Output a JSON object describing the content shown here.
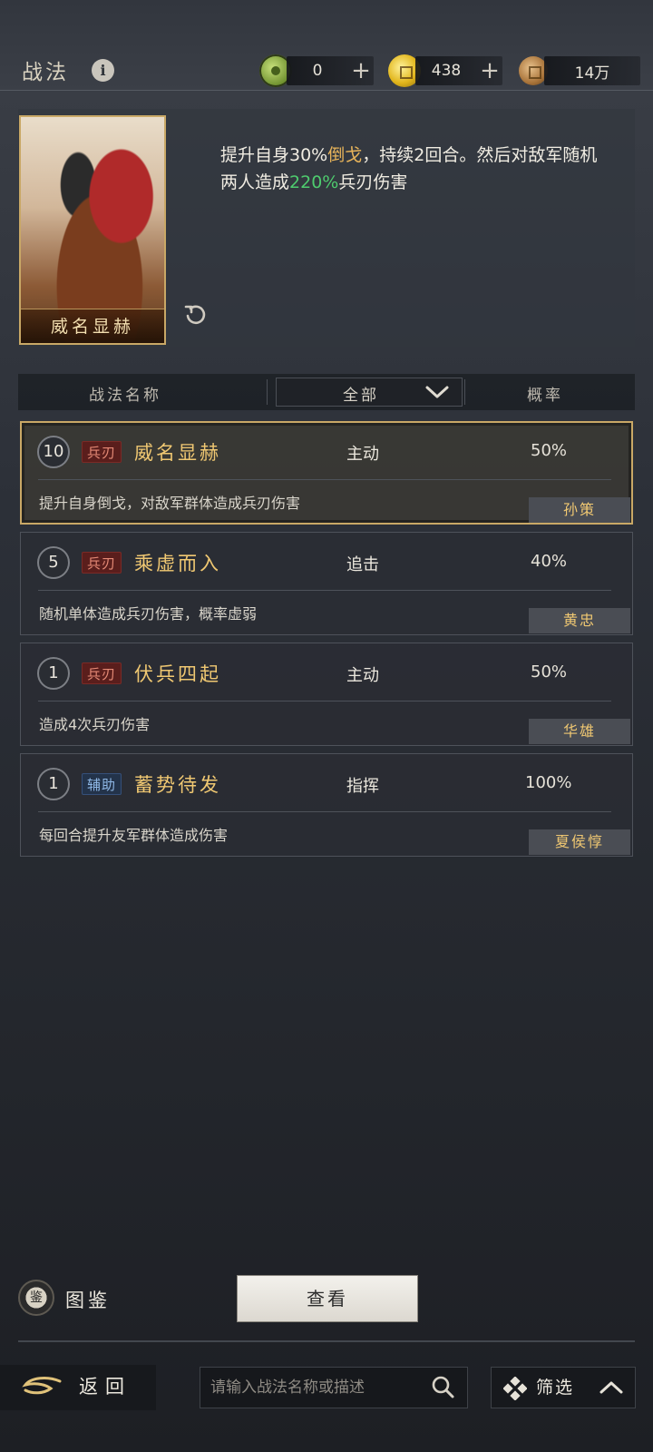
{
  "header": {
    "title": "战法",
    "info_icon": "info-icon",
    "resources": [
      {
        "icon": "jade-coin-icon",
        "value": "0",
        "has_plus": true
      },
      {
        "icon": "gold-coin-icon",
        "value": "438",
        "has_plus": true
      },
      {
        "icon": "copper-coin-icon",
        "value": "14万",
        "has_plus": false
      }
    ],
    "plus_symbol": "+"
  },
  "hero": {
    "card_name": "威名显赫",
    "description": {
      "p1": "提升自身30%",
      "highlight1": "倒戈",
      "p2": "，持续2回合。然后对敌军随机两人造成",
      "highlight2": "220%",
      "p3": "兵刃伤害"
    },
    "highlight_colors": {
      "gold": "#e7b35a",
      "green": "#4ecb6e"
    }
  },
  "list_header": {
    "name_col": "战法名称",
    "filter_value": "全部",
    "rate_col": "概率"
  },
  "skills": [
    {
      "level": "10",
      "tag": "兵刃",
      "tag_color": "red",
      "name": "威名显赫",
      "type": "主动",
      "rate": "50%",
      "desc": "提升自身倒戈，对敌军群体造成兵刃伤害",
      "owner": "孙策",
      "selected": true
    },
    {
      "level": "5",
      "tag": "兵刃",
      "tag_color": "red",
      "name": "乘虚而入",
      "type": "追击",
      "rate": "40%",
      "desc": "随机单体造成兵刃伤害，概率虚弱",
      "owner": "黄忠",
      "selected": false
    },
    {
      "level": "1",
      "tag": "兵刃",
      "tag_color": "red",
      "name": "伏兵四起",
      "type": "主动",
      "rate": "50%",
      "desc": "造成4次兵刃伤害",
      "owner": "华雄",
      "selected": false
    },
    {
      "level": "1",
      "tag": "辅助",
      "tag_color": "blue",
      "name": "蓄势待发",
      "type": "指挥",
      "rate": "100%",
      "desc": "每回合提升友军群体造成伤害",
      "owner": "夏侯惇",
      "selected": false
    }
  ],
  "footer": {
    "book_label": "图鉴",
    "book_icon_glyph": "鉴",
    "view_button": "查看",
    "back_label": "返回",
    "search_placeholder": "请输入战法名称或描述",
    "filter_label": "筛选"
  }
}
